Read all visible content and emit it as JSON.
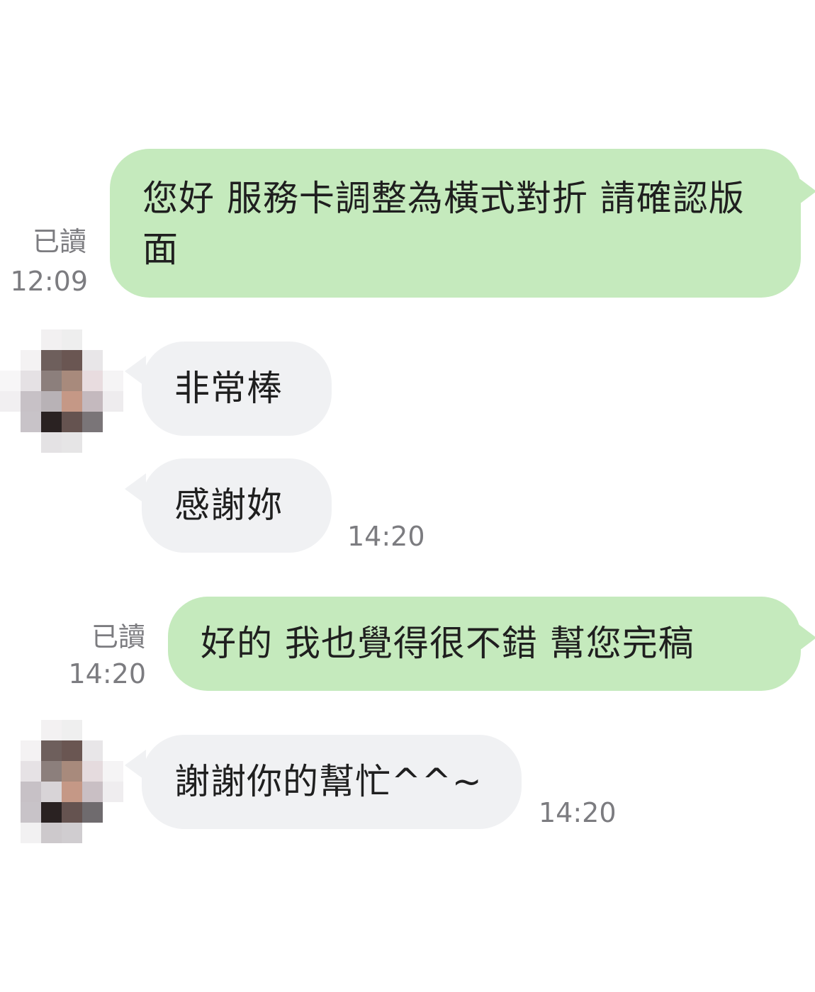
{
  "messages": [
    {
      "direction": "outgoing",
      "text": "您好 服務卡調整為橫式對折 請確認版面",
      "read_label": "已讀",
      "time": "12:09"
    },
    {
      "direction": "incoming",
      "text": "非常棒",
      "time": ""
    },
    {
      "direction": "incoming",
      "text": "感謝妳",
      "time": "14:20"
    },
    {
      "direction": "outgoing",
      "text": "好的 我也覺得很不錯 幫您完稿",
      "read_label": "已讀",
      "time": "14:20"
    },
    {
      "direction": "incoming",
      "text": "謝謝你的幫忙^^~",
      "time": "14:20"
    }
  ],
  "colors": {
    "outgoing_bubble": "#c5eabd",
    "incoming_bubble": "#f0f1f3",
    "meta_text": "#7c7c80",
    "message_text": "#1f1f1f"
  },
  "icons": {
    "contact_avatar": "pixelated-avatar-icon"
  }
}
